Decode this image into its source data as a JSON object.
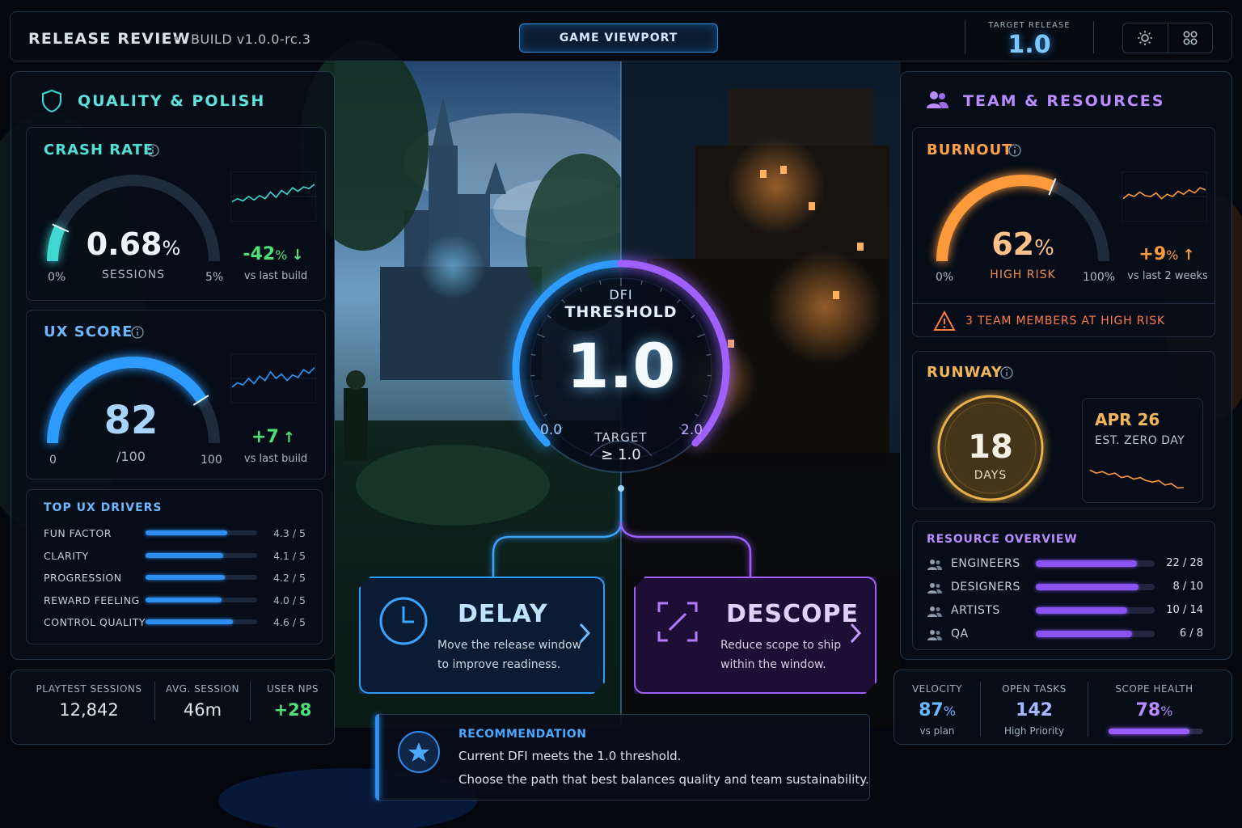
{
  "header": {
    "title": "RELEASE REVIEW",
    "separator": "•",
    "build": "BUILD v1.0.0-rc.3",
    "viewport_tab": "GAME VIEWPORT",
    "target_label": "TARGET RELEASE",
    "target_value": "1.0",
    "icons": [
      "sun-icon",
      "grid-icon"
    ]
  },
  "quality": {
    "title": "QUALITY & POLISH",
    "crash": {
      "title": "CRASH RATE",
      "value": "0.68",
      "unit": "%",
      "sublabel": "SESSIONS",
      "min": "0%",
      "max": "5%",
      "delta": "-42",
      "delta_unit": "%",
      "delta_arrow": "↓",
      "delta_caption": "vs last build",
      "gauge_fraction": 0.136,
      "spark": [
        0.62,
        0.55,
        0.6,
        0.5,
        0.58,
        0.48,
        0.55,
        0.4,
        0.52,
        0.36,
        0.45,
        0.3,
        0.38,
        0.28,
        0.32,
        0.22
      ]
    },
    "ux": {
      "title": "UX SCORE",
      "value": "82",
      "sublabel": "/100",
      "min": "0",
      "max": "100",
      "delta": "+7",
      "delta_arrow": "↑",
      "delta_caption": "vs last build",
      "gauge_fraction": 0.82,
      "spark": [
        0.7,
        0.6,
        0.65,
        0.5,
        0.62,
        0.45,
        0.55,
        0.35,
        0.5,
        0.4,
        0.55,
        0.42,
        0.48,
        0.3,
        0.38,
        0.25
      ]
    },
    "drivers": {
      "title": "TOP UX DRIVERS",
      "items": [
        {
          "label": "FUN FACTOR",
          "value": "4.3 / 5",
          "score": 4.3
        },
        {
          "label": "CLARITY",
          "value": "4.1 / 5",
          "score": 4.1
        },
        {
          "label": "PROGRESSION",
          "value": "4.2 / 5",
          "score": 4.2
        },
        {
          "label": "REWARD FEELING",
          "value": "4.0 / 5",
          "score": 4.0
        },
        {
          "label": "CONTROL QUALITY",
          "value": "4.6 / 5",
          "score": 4.6
        }
      ]
    }
  },
  "stats_left": [
    {
      "label": "PLAYTEST SESSIONS",
      "value": "12,842"
    },
    {
      "label": "AVG. SESSION",
      "value": "46m"
    },
    {
      "label": "USER NPS",
      "value": "+28"
    }
  ],
  "dfi": {
    "title_line1": "DFI",
    "title_line2": "THRESHOLD",
    "value": "1.0",
    "min": "0.0",
    "max": "2.0",
    "target_label": "TARGET",
    "target_value": "≥ 1.0",
    "fraction": 0.5
  },
  "options": {
    "delay": {
      "title": "DELAY",
      "line1": "Move the release window",
      "line2": "to improve readiness."
    },
    "descope": {
      "title": "DESCOPE",
      "line1": "Reduce scope to ship",
      "line2": "within the window."
    }
  },
  "recommendation": {
    "label": "RECOMMENDATION",
    "line1": "Current DFI meets the 1.0 threshold.",
    "line2": "Choose the path that best balances quality and team sustainability."
  },
  "team": {
    "title": "TEAM & RESOURCES",
    "burnout": {
      "title": "BURNOUT",
      "value": "62",
      "unit": "%",
      "sublabel": "HIGH RISK",
      "min": "0%",
      "max": "100%",
      "delta": "+9",
      "delta_unit": "%",
      "delta_arrow": "↑",
      "delta_caption": "vs last 2 weeks",
      "gauge_fraction": 0.62,
      "alert": "3 TEAM MEMBERS AT HIGH RISK",
      "spark": [
        0.55,
        0.45,
        0.5,
        0.4,
        0.48,
        0.5,
        0.42,
        0.55,
        0.45,
        0.5,
        0.38,
        0.45,
        0.35,
        0.42,
        0.3,
        0.35
      ]
    },
    "runway": {
      "title": "RUNWAY",
      "value": "18",
      "sublabel": "DAYS",
      "date": "APR 26",
      "date_caption": "EST. ZERO DAY",
      "spark": [
        0.2,
        0.3,
        0.25,
        0.35,
        0.3,
        0.45,
        0.4,
        0.5,
        0.45,
        0.55,
        0.6,
        0.55,
        0.7,
        0.65,
        0.8,
        0.78
      ]
    },
    "resources": {
      "title": "RESOURCE OVERVIEW",
      "items": [
        {
          "label": "ENGINEERS",
          "value": "22 / 28",
          "used": 22,
          "total": 28
        },
        {
          "label": "DESIGNERS",
          "value": "8 / 10",
          "used": 8,
          "total": 10
        },
        {
          "label": "ARTISTS",
          "value": "10 / 14",
          "used": 10,
          "total": 14
        },
        {
          "label": "QA",
          "value": "6 / 8",
          "used": 6,
          "total": 8
        }
      ]
    }
  },
  "stats_right": [
    {
      "label": "VELOCITY",
      "value": "87",
      "unit": "%",
      "caption": "vs plan"
    },
    {
      "label": "OPEN TASKS",
      "value": "142",
      "caption": "High Priority"
    },
    {
      "label": "SCOPE HEALTH",
      "value": "78",
      "unit": "%",
      "fraction": 0.78
    }
  ],
  "colors": {
    "teal": "#3fd9d2",
    "blue": "#2d9bff",
    "purple": "#a060ff",
    "orange": "#ff9a3c",
    "gold": "#e8b04a",
    "green": "#4fe07a",
    "alert": "#ff6a3c"
  }
}
